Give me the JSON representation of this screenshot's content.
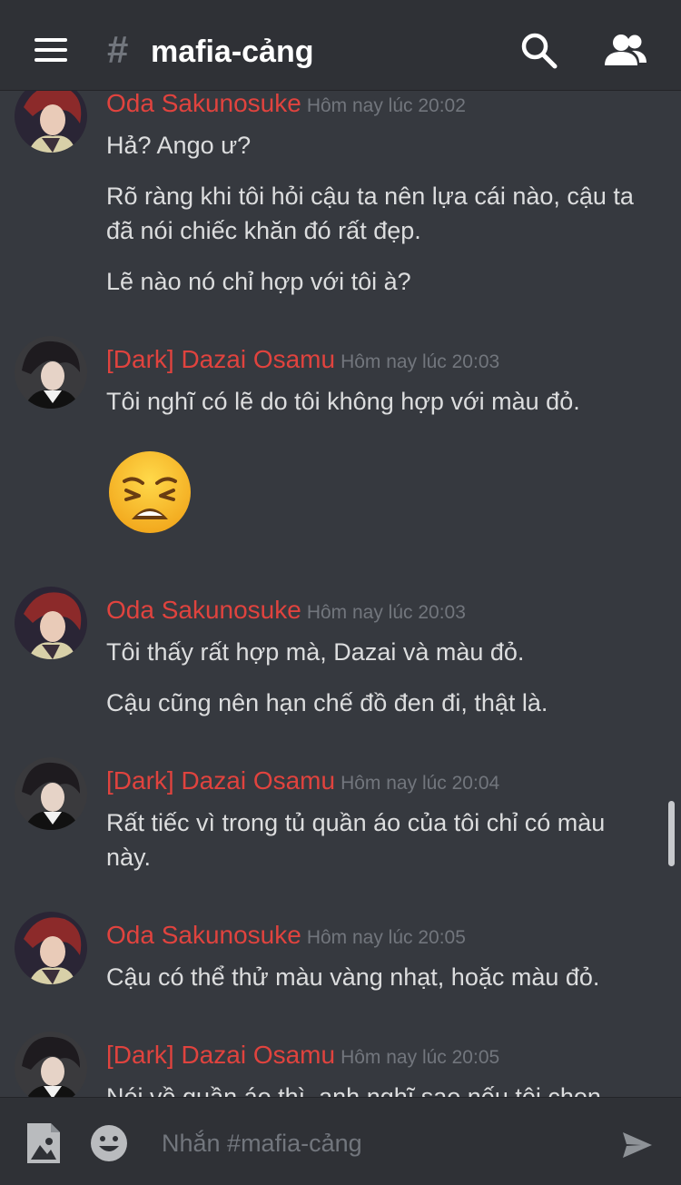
{
  "header": {
    "hash_icon": "#",
    "channel_name": "mafia-cảng",
    "menu_icon": "hamburger-icon",
    "search_icon": "search-icon",
    "members_icon": "members-icon"
  },
  "colors": {
    "background": "#36393f",
    "header": "#2f3136",
    "author_name": "#e0433e",
    "text": "#dcddde",
    "muted": "#72767d"
  },
  "messages": [
    {
      "author": "Oda Sakunosuke",
      "timestamp": "Hôm nay lúc 20:02",
      "lines": [
        "Hả? Ango ư?",
        "Rõ ràng khi tôi hỏi cậu ta nên lựa cái nào, cậu ta",
        "đã nói chiếc khăn đó rất đẹp.",
        "Lẽ nào nó chỉ hợp với tôi à?"
      ]
    },
    {
      "author": "[Dark] Dazai Osamu",
      "timestamp": "Hôm nay lúc 20:03",
      "lines": [
        "Tôi nghĩ có lẽ do tôi không hợp với màu đỏ."
      ],
      "emoji": "weary-face"
    },
    {
      "author": "Oda Sakunosuke",
      "timestamp": "Hôm nay lúc 20:03",
      "lines": [
        "Tôi thấy rất hợp mà, Dazai và màu đỏ.",
        "Cậu cũng nên hạn chế đồ đen đi, thật là."
      ]
    },
    {
      "author": "[Dark] Dazai Osamu",
      "timestamp": "Hôm nay lúc 20:04",
      "lines": [
        "Rất tiếc vì trong tủ quần áo của tôi chỉ có màu",
        "này."
      ]
    },
    {
      "author": "Oda Sakunosuke",
      "timestamp": "Hôm nay lúc 20:05",
      "lines": [
        "Cậu có thể thử màu vàng nhạt, hoặc màu đỏ."
      ]
    },
    {
      "author": "[Dark] Dazai Osamu",
      "timestamp": "Hôm nay lúc 20:05",
      "lines": [
        "Nói về quần áo thì, anh nghĩ sao nếu tôi chọn"
      ]
    }
  ],
  "composer": {
    "placeholder": "Nhắn #mafia-cảng",
    "image_icon": "image-upload-icon",
    "emoji_icon": "emoji-icon",
    "send_icon": "send-icon"
  }
}
